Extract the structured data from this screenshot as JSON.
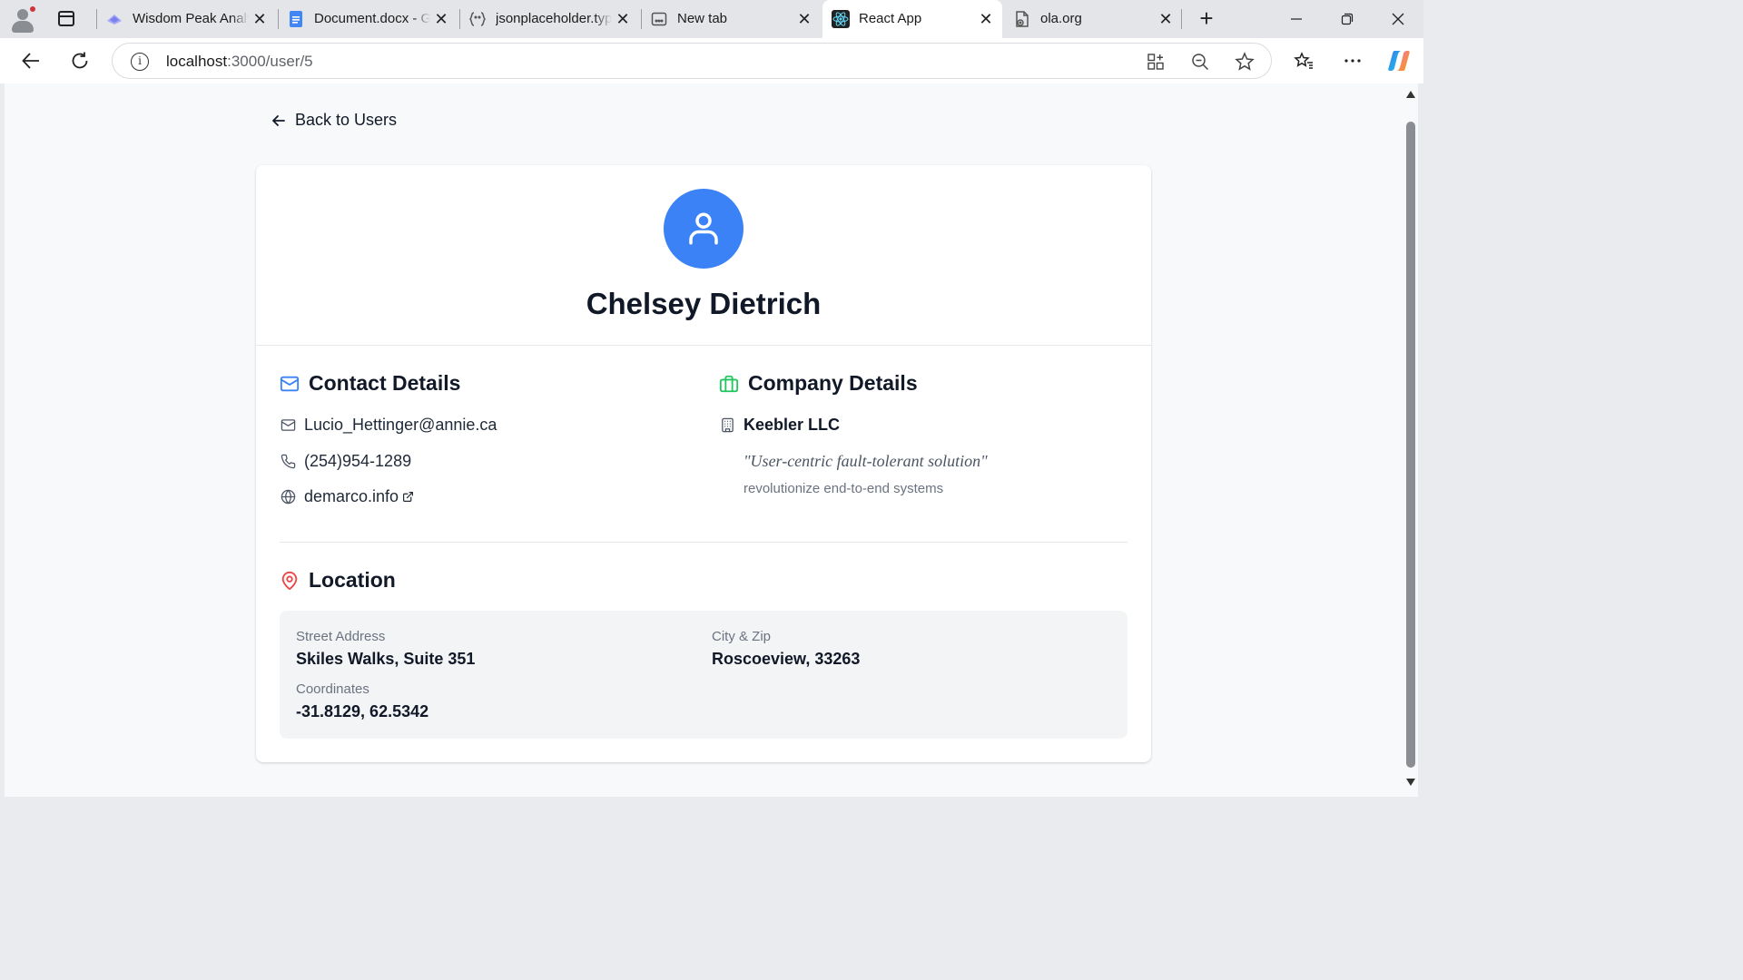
{
  "browser": {
    "tabs": [
      {
        "title": "Wisdom Peak Analy",
        "icon": "wisdom-peak-favicon",
        "active": false
      },
      {
        "title": "Document.docx - G",
        "icon": "google-docs-favicon",
        "active": false
      },
      {
        "title": "jsonplaceholder.typ",
        "icon": "jsonplaceholder-favicon",
        "active": false
      },
      {
        "title": "New tab",
        "icon": "new-tab-favicon",
        "active": false
      },
      {
        "title": "React App",
        "icon": "react-favicon",
        "active": true
      },
      {
        "title": "ola.org",
        "icon": "ola-favicon",
        "active": false
      }
    ],
    "url_host": "localhost",
    "url_rest": ":3000/user/5",
    "accent": "#3b82f6"
  },
  "page": {
    "back_label": "Back to Users",
    "user": {
      "name": "Chelsey Dietrich"
    },
    "contact": {
      "title": "Contact Details",
      "email": "Lucio_Hettinger@annie.ca",
      "phone": "(254)954-1289",
      "website": "demarco.info"
    },
    "company": {
      "title": "Company Details",
      "name": "Keebler LLC",
      "catch_phrase": "\"User-centric fault-tolerant solution\"",
      "bs": "revolutionize end-to-end systems"
    },
    "location": {
      "title": "Location",
      "street_label": "Street Address",
      "street_value": "Skiles Walks, Suite 351",
      "city_label": "City & Zip",
      "city_value": "Roscoeview, 33263",
      "coords_label": "Coordinates",
      "coords_value": "-31.8129, 62.5342"
    },
    "colors": {
      "contact_icon": "#3b82f6",
      "company_icon": "#22c55e",
      "location_icon": "#ef4444"
    }
  }
}
